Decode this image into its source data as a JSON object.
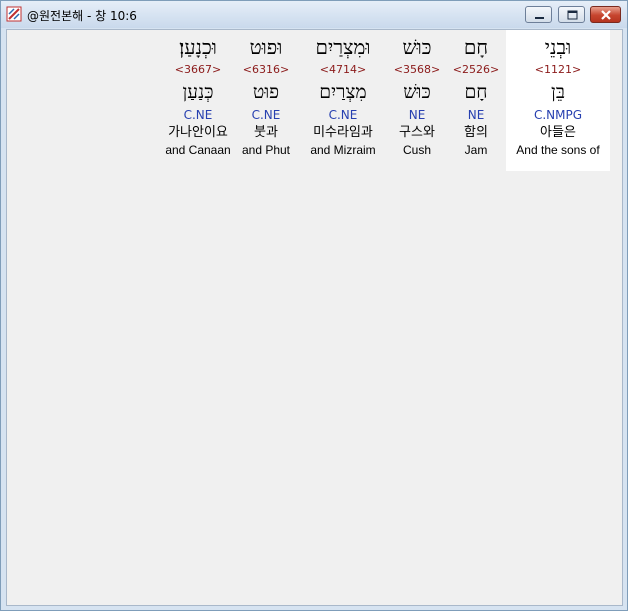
{
  "window": {
    "title": "@원전본해 - 창 10:6",
    "icon": "bible-app-icon",
    "controls": {
      "minimize": "minimize-icon",
      "maximize": "maximize-icon",
      "close": "close-icon"
    }
  },
  "words": [
    {
      "hebrew": "וּבְנֵי",
      "strong": "<1121>",
      "lemma": "בֵּן",
      "morph": "C.NMPG",
      "korean": "아들은",
      "english": "And the sons of",
      "selected": true
    },
    {
      "hebrew": "חָם",
      "strong": "<2526>",
      "lemma": "חָם",
      "morph": "NE",
      "korean": "함의",
      "english": "Jam"
    },
    {
      "hebrew": "כּוּשׁ",
      "strong": "<3568>",
      "lemma": "כּוּשׁ",
      "morph": "NE",
      "korean": "구스와",
      "english": "Cush"
    },
    {
      "hebrew": "וּמִצְרַיִם",
      "strong": "<4714>",
      "lemma": "מִצְרַיִם",
      "morph": "C.NE",
      "korean": "미수라임과",
      "english": "and Mizraim"
    },
    {
      "hebrew": "וּפוּט",
      "strong": "<6316>",
      "lemma": "פוּט",
      "morph": "C.NE",
      "korean": "붓과",
      "english": "and Phut"
    },
    {
      "hebrew": "וּכְנָעַן׃",
      "strong": "<3667>",
      "lemma": "כְּנַעַן",
      "morph": "C.NE",
      "korean": "가나안이요",
      "english": "and Canaan"
    }
  ],
  "colors": {
    "strong": "#8b1a1a",
    "morph": "#2740b0",
    "selected_bg": "#ffffff"
  }
}
